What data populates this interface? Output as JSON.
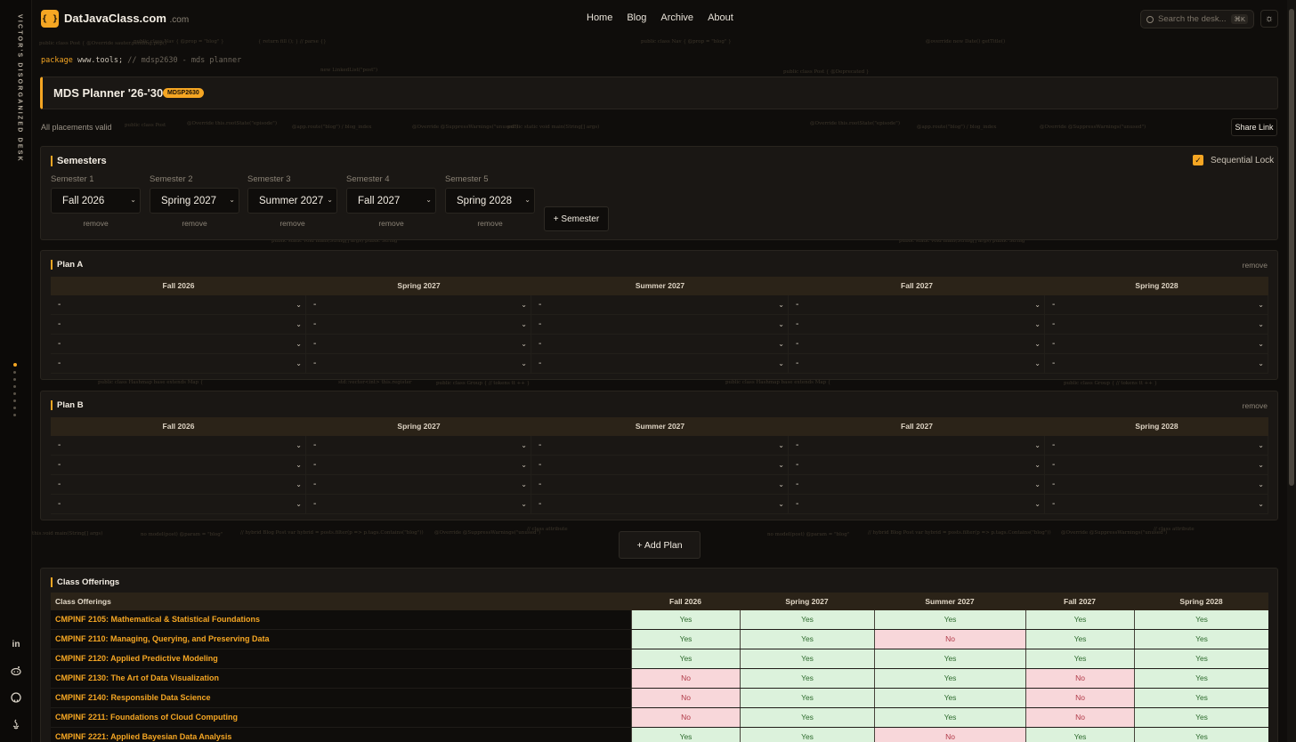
{
  "site": {
    "rail_title": "VICTOR'S DISORGANIZED DESK",
    "logo_glyph": "{ }",
    "name": "DatJavaClass.com",
    "suffix": ".com",
    "nav": [
      "Home",
      "Blog",
      "Archive",
      "About"
    ],
    "search_placeholder": "Search the desk...",
    "search_shortcut": "⌘K",
    "theme_icon": "☼",
    "social": [
      "in",
      "r",
      "gh",
      "j"
    ]
  },
  "breadcrumb": {
    "keyword": "package",
    "path": "www.tools;",
    "comment": "// mdsp2630 - mds planner"
  },
  "planner": {
    "title": "MDS Planner '26-'30",
    "badge": "MDSP2630",
    "status": "All placements valid",
    "share_label": "Share Link"
  },
  "semesters": {
    "heading": "Semesters",
    "sequential_lock_label": "Sequential Lock",
    "sequential_lock_checked": true,
    "check_glyph": "✓",
    "items": [
      {
        "label": "Semester 1",
        "value": "Fall 2026",
        "remove": "remove"
      },
      {
        "label": "Semester 2",
        "value": "Spring 2027",
        "remove": "remove"
      },
      {
        "label": "Semester 3",
        "value": "Summer 2027",
        "remove": "remove"
      },
      {
        "label": "Semester 4",
        "value": "Fall 2027",
        "remove": "remove"
      },
      {
        "label": "Semester 5",
        "value": "Spring 2028",
        "remove": "remove"
      }
    ],
    "add_label": "+ Semester"
  },
  "plans": [
    {
      "name": "Plan A",
      "remove": "remove",
      "columns": [
        "Fall 2026",
        "Spring 2027",
        "Summer 2027",
        "Fall 2027",
        "Spring 2028"
      ],
      "rows": [
        [
          "-",
          "-",
          "-",
          "-",
          "-"
        ],
        [
          "-",
          "-",
          "-",
          "-",
          "-"
        ],
        [
          "-",
          "-",
          "-",
          "-",
          "-"
        ],
        [
          "-",
          "-",
          "-",
          "-",
          "-"
        ]
      ]
    },
    {
      "name": "Plan B",
      "remove": "remove",
      "columns": [
        "Fall 2026",
        "Spring 2027",
        "Summer 2027",
        "Fall 2027",
        "Spring 2028"
      ],
      "rows": [
        [
          "-",
          "-",
          "-",
          "-",
          "-"
        ],
        [
          "-",
          "-",
          "-",
          "-",
          "-"
        ],
        [
          "-",
          "-",
          "-",
          "-",
          "-"
        ],
        [
          "-",
          "-",
          "-",
          "-",
          "-"
        ]
      ]
    }
  ],
  "add_plan_label": "+ Add Plan",
  "offerings": {
    "heading": "Class Offerings",
    "header_first": "Class Offerings",
    "columns": [
      "Fall 2026",
      "Spring 2027",
      "Summer 2027",
      "Fall 2027",
      "Spring 2028"
    ],
    "rows": [
      {
        "course": "CMPINF 2105: Mathematical & Statistical Foundations",
        "cells": [
          "Yes",
          "Yes",
          "Yes",
          "Yes",
          "Yes"
        ]
      },
      {
        "course": "CMPINF 2110: Managing, Querying, and Preserving Data",
        "cells": [
          "Yes",
          "Yes",
          "No",
          "Yes",
          "Yes"
        ]
      },
      {
        "course": "CMPINF 2120: Applied Predictive Modeling",
        "cells": [
          "Yes",
          "Yes",
          "Yes",
          "Yes",
          "Yes"
        ]
      },
      {
        "course": "CMPINF 2130: The Art of Data Visualization",
        "cells": [
          "No",
          "Yes",
          "Yes",
          "No",
          "Yes"
        ]
      },
      {
        "course": "CMPINF 2140: Responsible Data Science",
        "cells": [
          "No",
          "Yes",
          "Yes",
          "No",
          "Yes"
        ]
      },
      {
        "course": "CMPINF 2211: Foundations of Cloud Computing",
        "cells": [
          "No",
          "Yes",
          "Yes",
          "No",
          "Yes"
        ]
      },
      {
        "course": "CMPINF 2221: Applied Bayesian Data Analysis",
        "cells": [
          "Yes",
          "Yes",
          "No",
          "Yes",
          "Yes"
        ]
      }
    ]
  },
  "colors": {
    "accent": "#f5a623",
    "yes_bg": "#dcf2dc",
    "no_bg": "#f8d7da"
  }
}
